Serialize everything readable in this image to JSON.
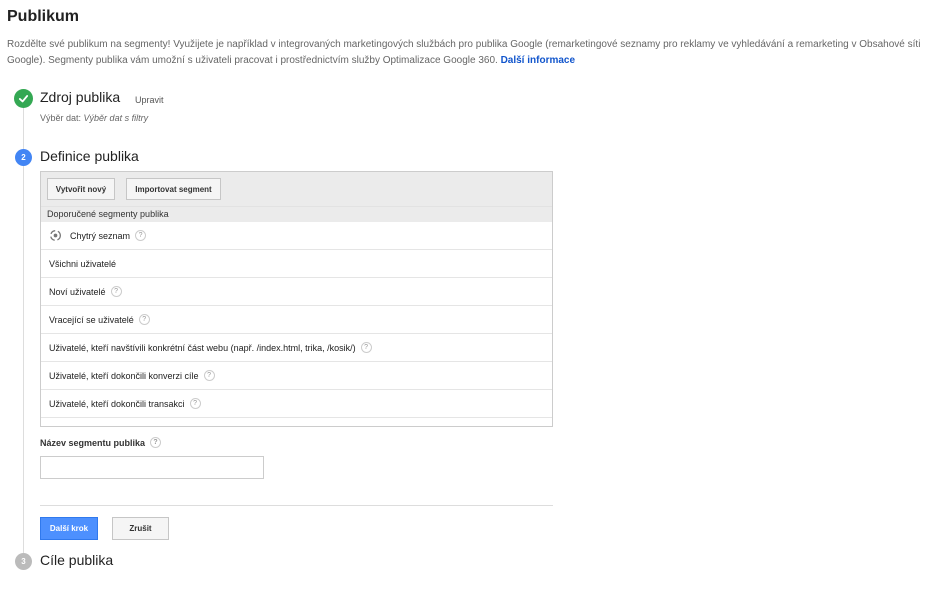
{
  "page": {
    "title": "Publikum",
    "intro_text": "Rozdělte své publikum na segmenty! Využijete je například v integrovaných marketingových službách pro publika Google (remarketingové seznamy pro reklamy ve vyhledávání a remarketing v Obsahové síti Google). Segmenty publika vám umožní s uživateli pracovat i prostřednictvím služby Optimalizace Google 360.",
    "intro_link": "Další informace"
  },
  "steps": {
    "step1": {
      "title": "Zdroj publika",
      "edit_label": "Upravit",
      "data_label": "Výběr dat:",
      "data_value": "Výběr dat s filtry",
      "status_icon": "check-icon"
    },
    "step2": {
      "number": "2",
      "title": "Definice publika"
    },
    "step3": {
      "number": "3",
      "title": "Cíle publika"
    }
  },
  "segments_panel": {
    "create_button": "Vytvořit nový",
    "import_button": "Importovat segment",
    "header": "Doporučené segmenty publika",
    "items": [
      {
        "label": "Chytrý seznam",
        "icon": "smart-list-icon",
        "help": "?"
      },
      {
        "label": "Všichni uživatelé",
        "help": ""
      },
      {
        "label": "Noví uživatelé",
        "help": "?"
      },
      {
        "label": "Vracející se uživatelé",
        "help": "?"
      },
      {
        "label": "Uživatelé, kteří navštívili konkrétní část webu (např. /index.html, trika, /kosik/)",
        "help": "?"
      },
      {
        "label": "Uživatelé, kteří dokončili konverzi cíle",
        "help": "?"
      },
      {
        "label": "Uživatelé, kteří dokončili transakci",
        "help": "?"
      }
    ]
  },
  "segment_name": {
    "label": "Název segmentu publika",
    "help": "?",
    "value": "",
    "placeholder": ""
  },
  "actions": {
    "next_label": "Další krok",
    "cancel_label": "Zrušit"
  },
  "colors": {
    "primary": "#4d90fe",
    "success": "#34a853",
    "active_step": "#4285f4",
    "inactive_step": "#bbbbbb",
    "link": "#1155cc"
  }
}
